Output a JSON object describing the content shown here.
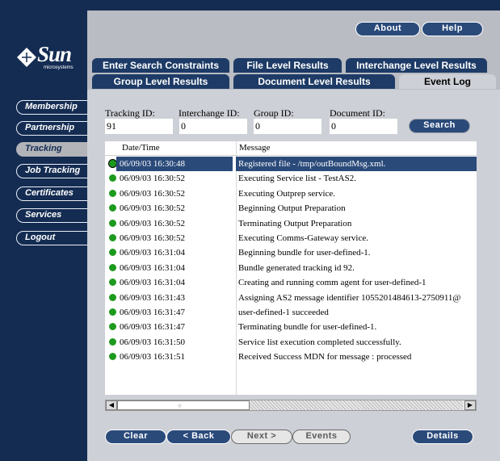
{
  "branding": {
    "logo_text": "Sun",
    "logo_sub": "microsystems"
  },
  "header": {
    "about_label": "About",
    "help_label": "Help"
  },
  "tabs": {
    "row1": [
      "Enter Search Constraints",
      "File Level Results",
      "Interchange Level Results"
    ],
    "row2": [
      "Group Level Results",
      "Document Level Results",
      "Event Log"
    ],
    "active": "Event Log"
  },
  "sidebar": {
    "items": [
      {
        "label": "Membership",
        "active": false
      },
      {
        "label": "Partnership",
        "active": false
      },
      {
        "label": "Tracking",
        "active": true
      },
      {
        "label": "Job Tracking",
        "active": false
      },
      {
        "label": "Certificates",
        "active": false
      },
      {
        "label": "Services",
        "active": false
      },
      {
        "label": "Logout",
        "active": false
      }
    ]
  },
  "search": {
    "tracking_label": "Tracking ID:",
    "tracking_value": "91",
    "interchange_label": "Interchange ID:",
    "interchange_value": "0",
    "group_label": "Group ID:",
    "group_value": "0",
    "document_label": "Document ID:",
    "document_value": "0",
    "search_button": "Search"
  },
  "table": {
    "columns": [
      "Date/Time",
      "Message"
    ],
    "rows": [
      {
        "datetime": "06/09/03 16:30:48",
        "message": "Registered file - /tmp/outBoundMsg.xml.",
        "selected": true
      },
      {
        "datetime": "06/09/03 16:30:52",
        "message": "Executing Service list - TestAS2."
      },
      {
        "datetime": "06/09/03 16:30:52",
        "message": "Executing Outprep service."
      },
      {
        "datetime": "06/09/03 16:30:52",
        "message": "Beginning Output Preparation"
      },
      {
        "datetime": "06/09/03 16:30:52",
        "message": "Terminating Output Preparation"
      },
      {
        "datetime": "06/09/03 16:30:52",
        "message": "Executing Comms-Gateway service."
      },
      {
        "datetime": "06/09/03 16:31:04",
        "message": "Beginning bundle for user-defined-1."
      },
      {
        "datetime": "06/09/03 16:31:04",
        "message": "Bundle generated tracking id 92."
      },
      {
        "datetime": "06/09/03 16:31:04",
        "message": "Creating and running comm agent for user-defined-1"
      },
      {
        "datetime": "06/09/03 16:31:43",
        "message": "Assigning AS2 message identifier 1055201484613-2750911@"
      },
      {
        "datetime": "06/09/03 16:31:47",
        "message": "user-defined-1 succeeded"
      },
      {
        "datetime": "06/09/03 16:31:47",
        "message": "Terminating bundle for user-defined-1."
      },
      {
        "datetime": "06/09/03 16:31:50",
        "message": "Service list execution completed successfully."
      },
      {
        "datetime": "06/09/03 16:31:51",
        "message": "Received Success MDN for message : processed"
      }
    ]
  },
  "footer": {
    "clear_button": "Clear",
    "back_button": "< Back",
    "next_button": "Next >",
    "events_button": "Events",
    "details_button": "Details"
  },
  "colors": {
    "navy": "#142c52",
    "button_blue": "#2a4a7a",
    "status_green": "#1d9a1d",
    "panel_gray": "#cdd0d6"
  },
  "icons": {
    "status": "green-status-dot-icon",
    "scroll_left": "arrow-left-icon",
    "scroll_right": "arrow-right-icon"
  }
}
